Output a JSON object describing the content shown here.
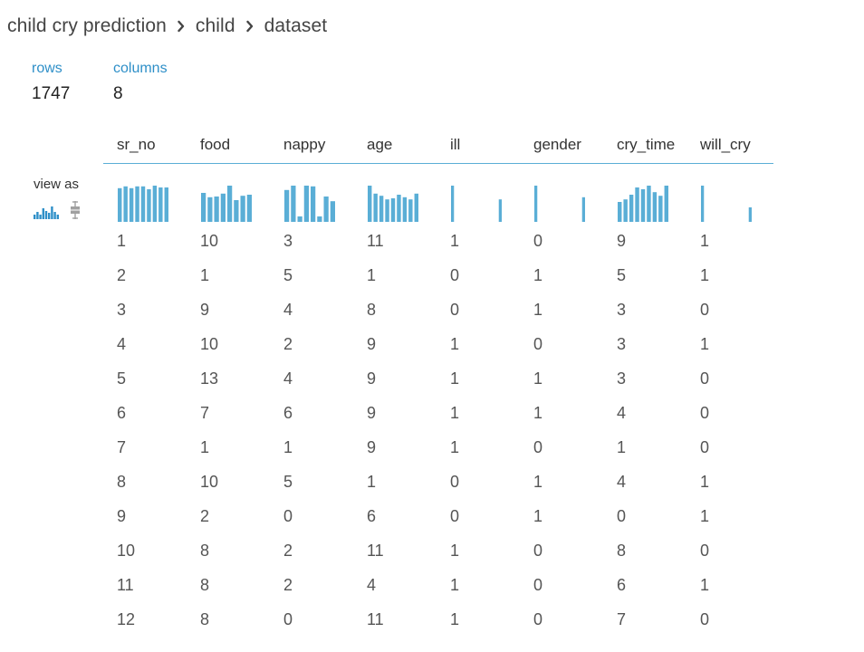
{
  "breadcrumb": {
    "items": [
      "child cry prediction",
      "child",
      "dataset"
    ]
  },
  "stats": {
    "rows_label": "rows",
    "rows_value": "1747",
    "columns_label": "columns",
    "columns_value": "8"
  },
  "view_as": {
    "label": "view as",
    "icons": [
      "histogram-icon",
      "boxplot-icon"
    ],
    "active": "histogram-icon"
  },
  "colors": {
    "accent": "#2e8fc8",
    "bar": "#5aaed6",
    "header_rule": "#5aaed6",
    "inactive_icon": "#a0a0a0"
  },
  "table": {
    "columns": [
      "sr_no",
      "food",
      "nappy",
      "age",
      "ill",
      "gender",
      "cry_time",
      "will_cry"
    ],
    "histograms": [
      [
        0.93,
        0.98,
        0.93,
        0.98,
        0.98,
        0.9,
        1.0,
        0.95,
        0.95
      ],
      [
        0.8,
        0.68,
        0.7,
        0.78,
        1.0,
        0.6,
        0.72,
        0.75
      ],
      [
        0.88,
        1.0,
        0.15,
        1.0,
        0.98,
        0.15,
        0.7,
        0.57
      ],
      [
        1.0,
        0.78,
        0.72,
        0.62,
        0.65,
        0.75,
        0.68,
        0.62,
        0.78
      ],
      [
        1.0,
        0,
        0,
        0,
        0,
        0,
        0,
        0,
        0,
        0,
        0.62
      ],
      [
        1.0,
        0,
        0,
        0,
        0,
        0,
        0,
        0,
        0,
        0,
        0.68
      ],
      [
        0.55,
        0.62,
        0.75,
        0.95,
        0.9,
        1.0,
        0.82,
        0.72,
        1.0
      ],
      [
        1.0,
        0,
        0,
        0,
        0,
        0,
        0,
        0,
        0,
        0,
        0.4
      ]
    ],
    "rows": [
      [
        "1",
        "10",
        "3",
        "11",
        "1",
        "0",
        "9",
        "1"
      ],
      [
        "2",
        "1",
        "5",
        "1",
        "0",
        "1",
        "5",
        "1"
      ],
      [
        "3",
        "9",
        "4",
        "8",
        "0",
        "1",
        "3",
        "0"
      ],
      [
        "4",
        "10",
        "2",
        "9",
        "1",
        "0",
        "3",
        "1"
      ],
      [
        "5",
        "13",
        "4",
        "9",
        "1",
        "1",
        "3",
        "0"
      ],
      [
        "6",
        "7",
        "6",
        "9",
        "1",
        "1",
        "4",
        "0"
      ],
      [
        "7",
        "1",
        "1",
        "9",
        "1",
        "0",
        "1",
        "0"
      ],
      [
        "8",
        "10",
        "5",
        "1",
        "0",
        "1",
        "4",
        "1"
      ],
      [
        "9",
        "2",
        "0",
        "6",
        "0",
        "1",
        "0",
        "1"
      ],
      [
        "10",
        "8",
        "2",
        "11",
        "1",
        "0",
        "8",
        "0"
      ],
      [
        "11",
        "8",
        "2",
        "4",
        "1",
        "0",
        "6",
        "1"
      ],
      [
        "12",
        "8",
        "0",
        "11",
        "1",
        "0",
        "7",
        "0"
      ]
    ]
  }
}
